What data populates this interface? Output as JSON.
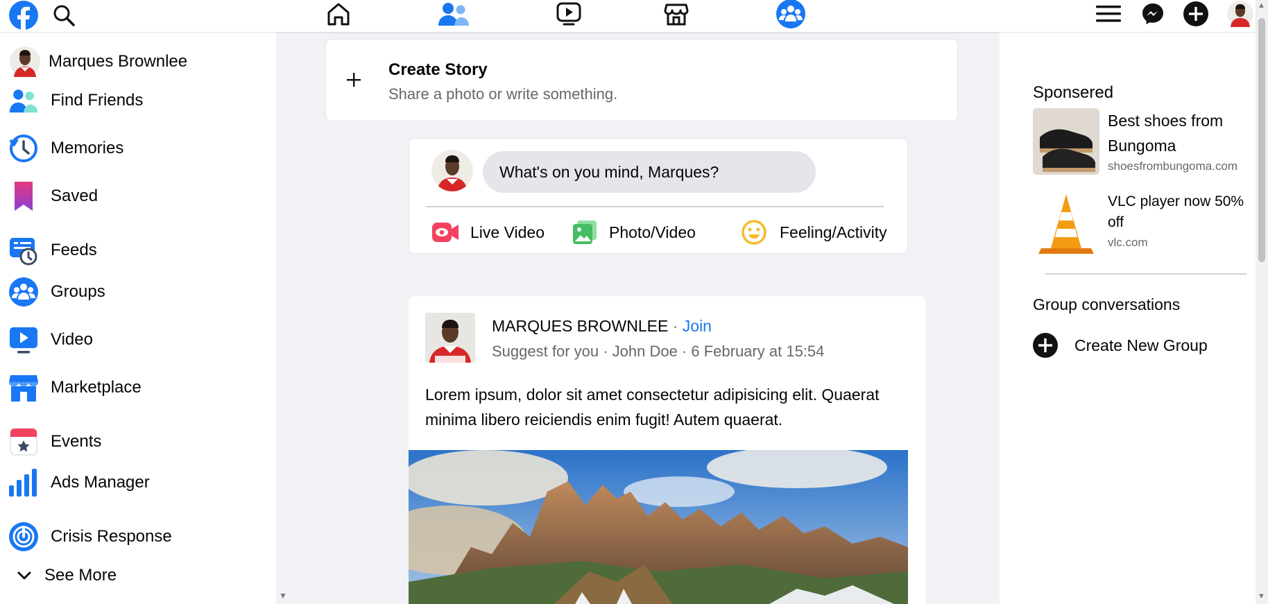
{
  "user": {
    "name": "Marques Brownlee",
    "first_name": "Marques"
  },
  "topbar": {
    "nav_icons": [
      "home-icon",
      "friends-icon",
      "watch-icon",
      "marketplace-icon",
      "groups-icon"
    ],
    "right_icons": [
      "menu-icon",
      "messenger-icon",
      "create-icon",
      "account-avatar"
    ],
    "brand_color": "#1877f2"
  },
  "sidebar": {
    "items": [
      {
        "label": "Marques Brownlee",
        "icon": "profile-avatar"
      },
      {
        "label": "Find Friends",
        "icon": "friends-icon"
      },
      {
        "label": "Memories",
        "icon": "memories-icon"
      },
      {
        "label": "Saved",
        "icon": "bookmark-icon"
      },
      {
        "label": "Feeds",
        "icon": "feeds-icon"
      },
      {
        "label": "Groups",
        "icon": "groups-icon"
      },
      {
        "label": "Video",
        "icon": "video-icon"
      },
      {
        "label": "Marketplace",
        "icon": "marketplace-icon"
      },
      {
        "label": "Events",
        "icon": "events-icon"
      },
      {
        "label": "Ads Manager",
        "icon": "ads-manager-icon"
      },
      {
        "label": "Crisis Response",
        "icon": "crisis-response-icon"
      }
    ],
    "see_more": "See More"
  },
  "story": {
    "title": "Create Story",
    "subtitle": "Share a photo or write something."
  },
  "composer": {
    "placeholder": "What's on you mind, Marques?",
    "actions": [
      {
        "label": "Live Video",
        "icon": "live-video-icon",
        "color": "#f3425f"
      },
      {
        "label": "Photo/Video",
        "icon": "photo-video-icon",
        "color": "#45bd62"
      },
      {
        "label": "Feeling/Activity",
        "icon": "feeling-icon",
        "color": "#f7b928"
      }
    ]
  },
  "post": {
    "author": "MARQUES BROWNLEE",
    "separator": "·",
    "join": "Join",
    "meta": "Suggest for you · John Doe · 6 February at 15:54",
    "text": "Lorem ipsum, dolor sit amet consectetur adipisicing elit. Quaerat minima libero reiciendis enim fugit! Autem quaerat.",
    "link_color": "#1877f2"
  },
  "right": {
    "sponsored_title": "Sponsered",
    "ads": [
      {
        "title": "Best shoes from Bungoma",
        "domain": "shoesfrombungoma.com"
      },
      {
        "title": "VLC player now 50% off",
        "domain": "vlc.com"
      }
    ],
    "group_title": "Group conversations",
    "create_group": "Create New Group"
  }
}
